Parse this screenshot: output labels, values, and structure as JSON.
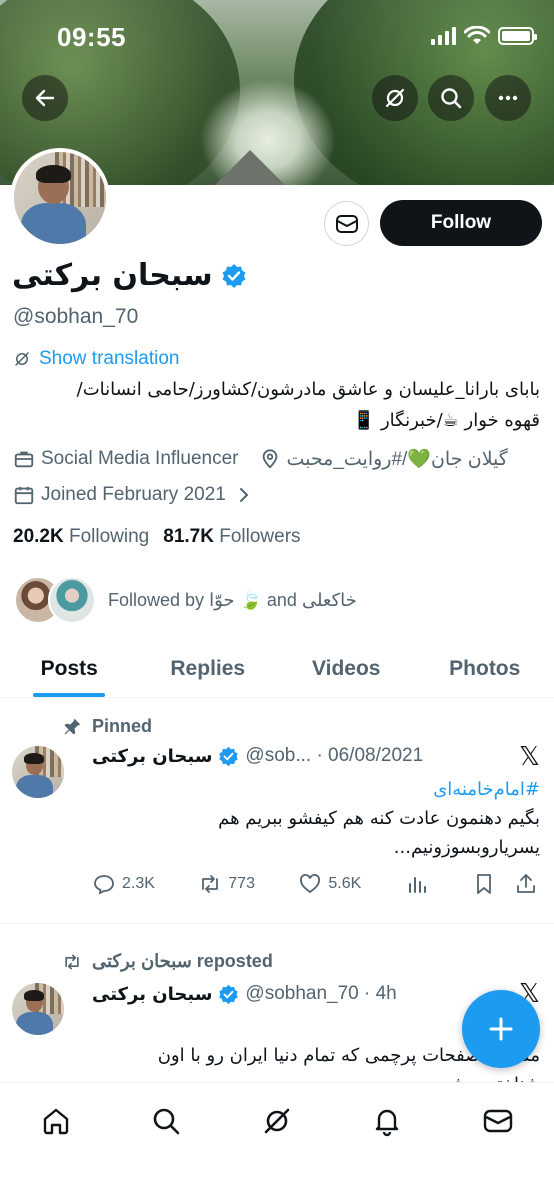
{
  "status_bar": {
    "time": "09:55"
  },
  "profile": {
    "display_name": "سبحان برکتی",
    "handle": "@sobhan_70",
    "follow_label": "Follow",
    "show_translation": "Show translation",
    "bio_line1": "بابای بارانا_علیسان و عاشق مادرشون/کشاورز/حامی انسانات/",
    "bio_line2": "قهوه خوار ☕/خبرنگار 📱",
    "category": "Social Media Influencer",
    "location": "گیلان جان💚/#روایت_محبت",
    "joined": "Joined February 2021",
    "following_count": "20.2K",
    "following_label": "Following",
    "followers_count": "81.7K",
    "followers_label": "Followers",
    "followed_by": "Followed by حوّا 🍃 and خاکعلی"
  },
  "tabs": [
    {
      "label": "Posts",
      "active": true
    },
    {
      "label": "Replies",
      "active": false
    },
    {
      "label": "Videos",
      "active": false
    },
    {
      "label": "Photos",
      "active": false
    }
  ],
  "tweets": [
    {
      "context": "Pinned",
      "name": "سبحان برکتی",
      "handle_time": "@sob... · 06/08/2021",
      "hashtag": "#امام‌خامنه‌ای",
      "text_line1": "بگیم دهنمون عادت کنه هم کیفشو ببریم هم",
      "text_line2": "یسریاروبسوزونیم...",
      "replies": "2.3K",
      "reposts": "773",
      "likes": "5.6K"
    },
    {
      "context": "سبحان برکتی reposted",
      "name": "سبحان برکتی",
      "handle_time": "@sobhan_70 · 4h",
      "text_line1": "مستفاذ صفحات پرچمی که تمام دنیا ایران رو با اون",
      "text_line2": "شناختن چشمه ..."
    }
  ],
  "colors": {
    "accent": "#1d9bf0",
    "text": "#0f1419",
    "muted": "#536471",
    "verified": "#1d9bf0"
  }
}
